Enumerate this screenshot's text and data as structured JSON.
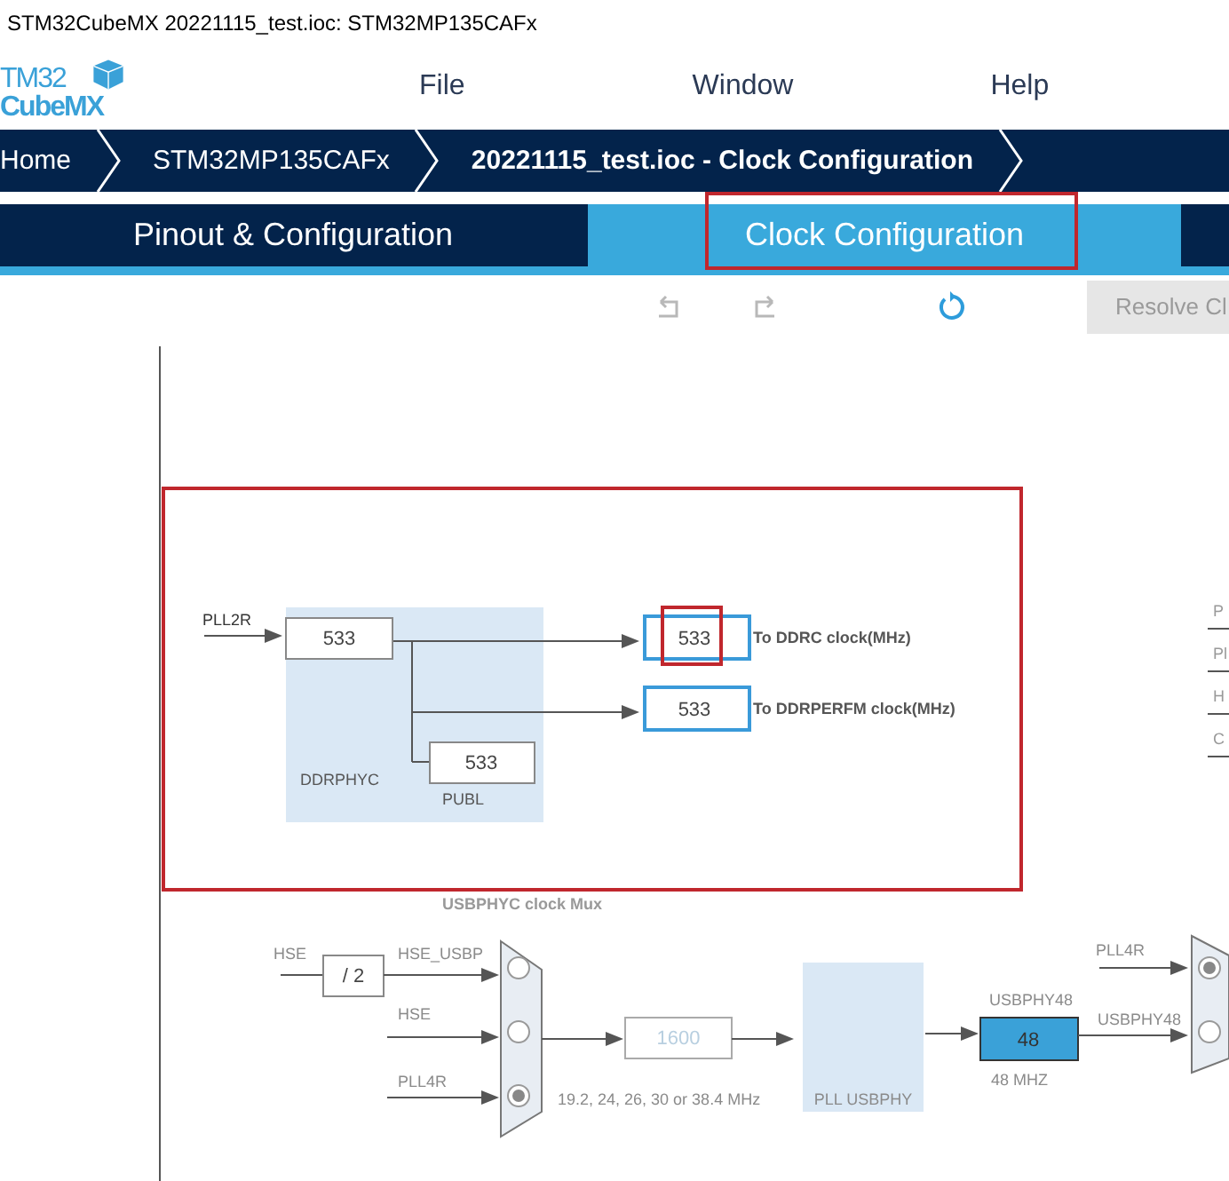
{
  "window": {
    "title": "STM32CubeMX 20221115_test.ioc: STM32MP135CAFx"
  },
  "logo": {
    "line1": "TM32",
    "line2": "CubeMX"
  },
  "menu": [
    "File",
    "Window",
    "Help"
  ],
  "breadcrumbs": [
    {
      "label": "Home",
      "selected": false
    },
    {
      "label": "STM32MP135CAFx",
      "selected": false
    },
    {
      "label": "20221115_test.ioc - Clock Configuration",
      "selected": true
    }
  ],
  "tabs": [
    {
      "label": "Pinout & Configuration",
      "selected": false,
      "annotated": false
    },
    {
      "label": "Clock Configuration",
      "selected": true,
      "annotated": true
    }
  ],
  "toolbar": {
    "tools": [
      {
        "kind": "undo",
        "disabled": true
      },
      {
        "kind": "redo",
        "disabled": true
      },
      {
        "kind": "reset",
        "disabled": false
      }
    ],
    "resolve_button": "Resolve Cl"
  },
  "ddr_section": {
    "annotated": true,
    "input": "PLL2R",
    "ddrphyc_value": "533",
    "ddrphyc_label": "DDRPHYC",
    "publ_value": "533",
    "publ_label": "PUBL",
    "outputs": [
      {
        "value": "533",
        "label": "To DDRC clock(MHz)",
        "annotated": true
      },
      {
        "value": "533",
        "label": "To DDRPERFM clock(MHz)",
        "annotated": false
      }
    ]
  },
  "legend": [
    "P",
    "Pl",
    "H",
    "C"
  ],
  "usb_section": {
    "title": "USBPHYC clock Mux",
    "divider_input": "HSE",
    "divider": "/ 2",
    "mux_inputs": [
      {
        "label": "HSE_USBP",
        "selected": false
      },
      {
        "label": "HSE",
        "selected": false
      },
      {
        "label": "PLL4R",
        "selected": true
      }
    ],
    "pll_input": {
      "value": "1600",
      "disabled": true
    },
    "range_note": "19.2, 24, 26, 30 or 38.4 MHz",
    "pll_label": "PLL USBPHY",
    "output_label": "USBPHY48",
    "output_value": "48",
    "output_note": "48 MHZ",
    "right_mux_inputs": [
      {
        "label": "PLL4R",
        "selected": true
      },
      {
        "label": "USBPHY48",
        "selected": false
      }
    ]
  }
}
